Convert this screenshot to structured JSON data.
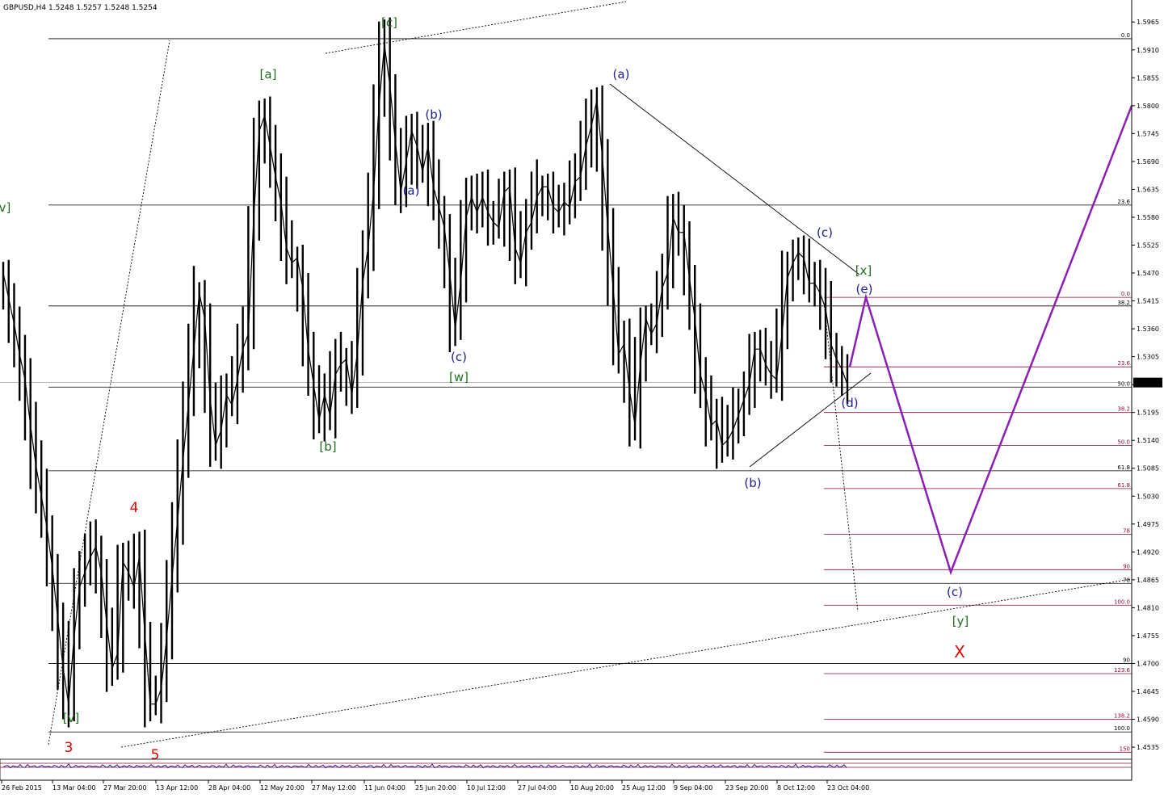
{
  "chart_data": {
    "type": "line",
    "title": "GBPUSD,H4  1.5248 1.5257 1.5248 1.5254",
    "last_price": "1.5254",
    "ylim": [
      1.4508,
      1.6002
    ],
    "y_ticks": [
      "1.5965",
      "1.5910",
      "1.5855",
      "1.5800",
      "1.5745",
      "1.5690",
      "1.5635",
      "1.5580",
      "1.5525",
      "1.5470",
      "1.5415",
      "1.5360",
      "1.5305",
      "1.5250",
      "1.5195",
      "1.5140",
      "1.5085",
      "1.5030",
      "1.4975",
      "1.4920",
      "1.4865",
      "1.4810",
      "1.4755",
      "1.4700",
      "1.4645",
      "1.4590",
      "1.4535"
    ],
    "x_ticks": [
      "26 Feb 2015",
      "13 Mar 04:00",
      "27 Mar 20:00",
      "13 Apr 12:00",
      "28 Apr 04:00",
      "12 May 20:00",
      "27 May 12:00",
      "11 Jun 04:00",
      "25 Jun 20:00",
      "10 Jul 12:00",
      "27 Jul 04:00",
      "10 Aug 20:00",
      "25 Aug 12:00",
      "9 Sep 04:00",
      "23 Sep 20:00",
      "8 Oct 12:00",
      "23 Oct 04:00"
    ],
    "series": [
      {
        "values": [
          1.547,
          1.542,
          1.537,
          1.531,
          1.526,
          1.517,
          1.509,
          1.503,
          1.497,
          1.489,
          1.479,
          1.469,
          1.462,
          1.475,
          1.485,
          1.488,
          1.491,
          1.493,
          1.488,
          1.478,
          1.469,
          1.472,
          1.49,
          1.488,
          1.485,
          1.491,
          1.476,
          1.462,
          1.462,
          1.465,
          1.475,
          1.487,
          1.498,
          1.51,
          1.521,
          1.532,
          1.543,
          1.538,
          1.522,
          1.513,
          1.516,
          1.523,
          1.521,
          1.526,
          1.532,
          1.535,
          1.558,
          1.575,
          1.578,
          1.572,
          1.566,
          1.561,
          1.552,
          1.549,
          1.55,
          1.544,
          1.532,
          1.525,
          1.518,
          1.523,
          1.519,
          1.527,
          1.529,
          1.53,
          1.523,
          1.531,
          1.545,
          1.552,
          1.563,
          1.58,
          1.592,
          1.584,
          1.573,
          1.563,
          1.569,
          1.575,
          1.572,
          1.567,
          1.572,
          1.564,
          1.56,
          1.556,
          1.547,
          1.536,
          1.545,
          1.558,
          1.562,
          1.559,
          1.562,
          1.559,
          1.557,
          1.556,
          1.563,
          1.564,
          1.552,
          1.549,
          1.555,
          1.557,
          1.562,
          1.564,
          1.564,
          1.56,
          1.559,
          1.561,
          1.56,
          1.565,
          1.566,
          1.572,
          1.576,
          1.581,
          1.57,
          1.556,
          1.544,
          1.531,
          1.533,
          1.524,
          1.517,
          1.529,
          1.538,
          1.535,
          1.537,
          1.544,
          1.547,
          1.558,
          1.555,
          1.555,
          1.546,
          1.538,
          1.527,
          1.523,
          1.517,
          1.518,
          1.513,
          1.514,
          1.516,
          1.519,
          1.522,
          1.525,
          1.532,
          1.532,
          1.529,
          1.527,
          1.526,
          1.535,
          1.546,
          1.549,
          1.551,
          1.55,
          1.545,
          1.545,
          1.543,
          1.54,
          1.533,
          1.53,
          1.528,
          1.525
        ]
      }
    ],
    "fib_levels_left": [
      {
        "label": "0.0",
        "price": 1.5932
      },
      {
        "label": "23.6",
        "price": 1.5604
      },
      {
        "label": "38.2",
        "price": 1.5405
      },
      {
        "label": "50.0",
        "price": 1.5245
      },
      {
        "label": "61.8",
        "price": 1.508
      },
      {
        "label": "78",
        "price": 1.4858
      },
      {
        "label": "90",
        "price": 1.47
      },
      {
        "label": "100.0",
        "price": 1.4565
      }
    ],
    "fib_levels_right": [
      {
        "label": "0.0",
        "price": 1.5422
      },
      {
        "label": "23.6",
        "price": 1.5285
      },
      {
        "label": "38.2",
        "price": 1.5195
      },
      {
        "label": "50.0",
        "price": 1.513
      },
      {
        "label": "61.8",
        "price": 1.5045
      },
      {
        "label": "78",
        "price": 1.4955
      },
      {
        "label": "90",
        "price": 1.4885
      },
      {
        "label": "100.0",
        "price": 1.4815
      },
      {
        "label": "123.6",
        "price": 1.468
      },
      {
        "label": "138.2",
        "price": 1.459
      },
      {
        "label": "150",
        "price": 1.4525
      }
    ],
    "wave_labels": [
      {
        "text": "[c]",
        "color": "#1f6e1f"
      },
      {
        "text": "[a]",
        "color": "#1f6e1f"
      },
      {
        "text": "(b)",
        "color": "#20208a"
      },
      {
        "text": "(a)",
        "color": "#20208a"
      },
      {
        "text": "(a)",
        "color": "#20208a"
      },
      {
        "text": "(c)",
        "color": "#20208a"
      },
      {
        "text": "[w]",
        "color": "#1f6e1f"
      },
      {
        "text": "[b]",
        "color": "#1f6e1f"
      },
      {
        "text": "(c)",
        "color": "#20208a"
      },
      {
        "text": "[x]",
        "color": "#1f6e1f"
      },
      {
        "text": "(e)",
        "color": "#20208a"
      },
      {
        "text": "(d)",
        "color": "#20208a"
      },
      {
        "text": "(b)",
        "color": "#20208a"
      },
      {
        "text": "(c)",
        "color": "#20208a"
      },
      {
        "text": "[y]",
        "color": "#1f6e1f"
      },
      {
        "text": "X",
        "color": "#e00000"
      },
      {
        "text": "[v]",
        "color": "#1f6e1f"
      },
      {
        "text": "v]",
        "color": "#1f6e1f"
      },
      {
        "text": "3",
        "color": "#e00000"
      },
      {
        "text": "4",
        "color": "#e00000"
      },
      {
        "text": "5",
        "color": "#e00000"
      }
    ],
    "projection": {
      "color": "#8b1fb4",
      "prices": [
        1.5285,
        1.5422,
        1.488,
        1.58
      ]
    },
    "grid": false
  }
}
